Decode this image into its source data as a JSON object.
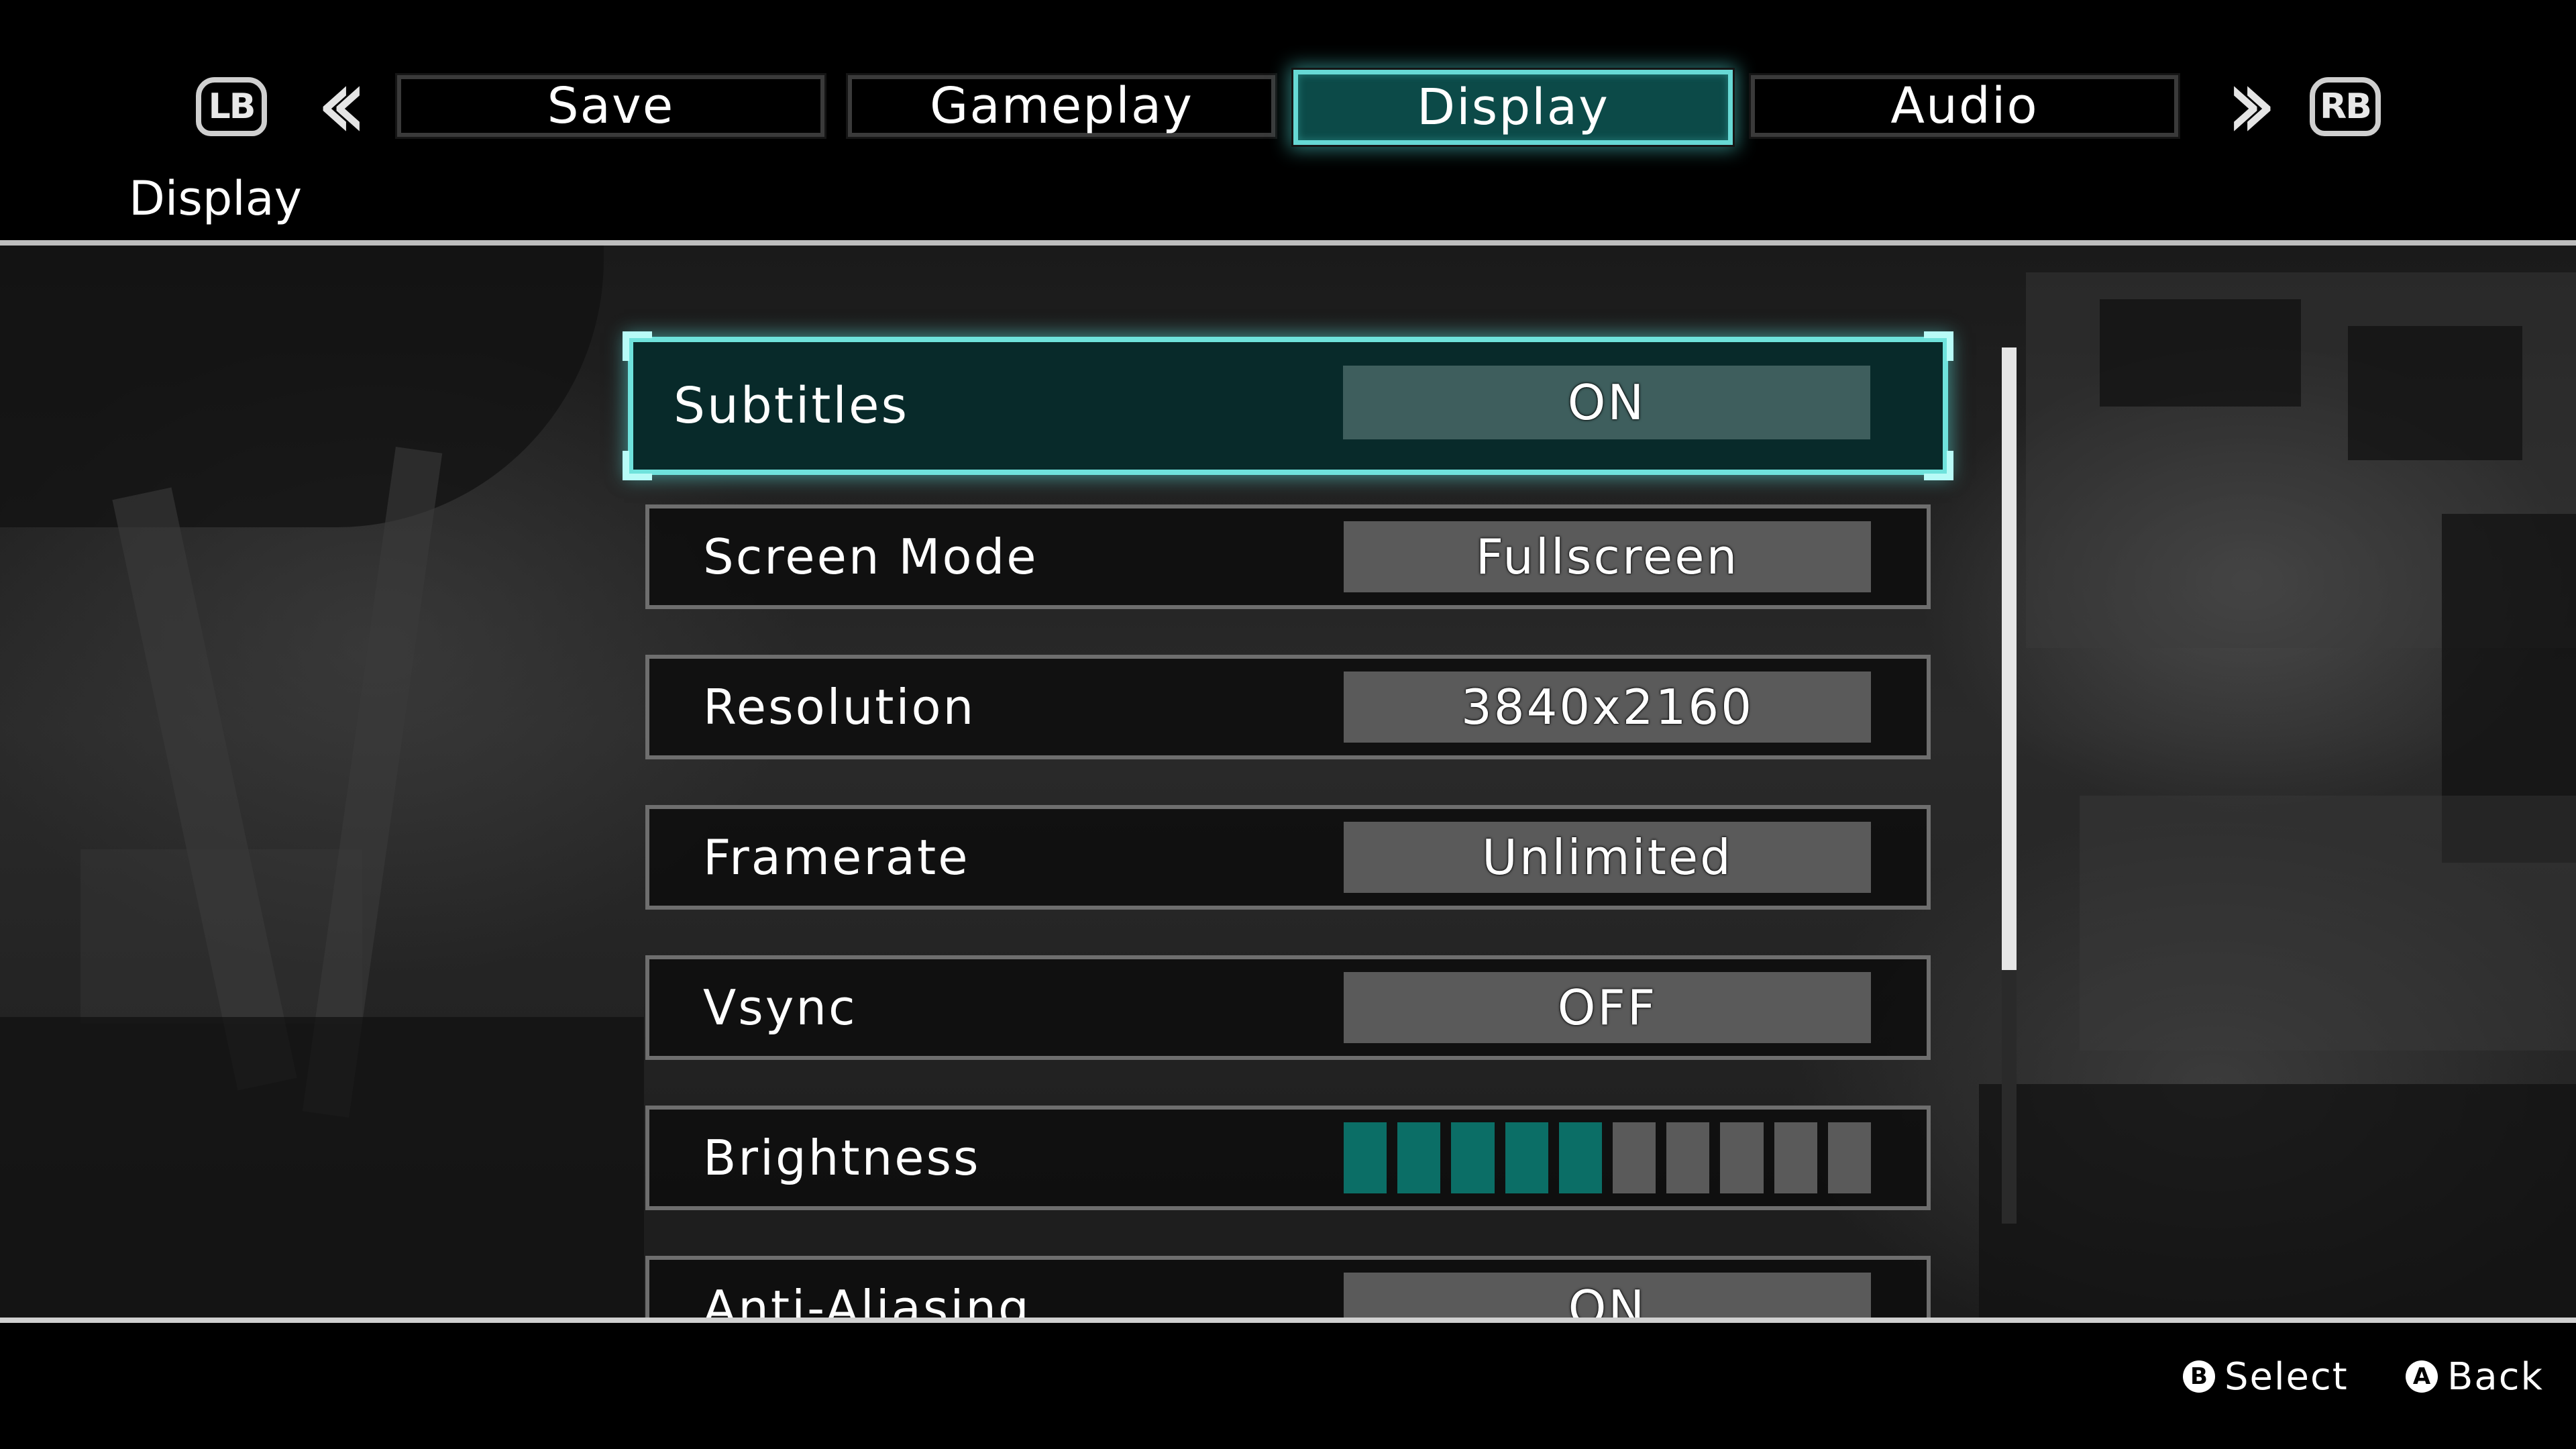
{
  "header": {
    "left_bumper": "LB",
    "right_bumper": "RB",
    "tabs": [
      {
        "label": "Save"
      },
      {
        "label": "Gameplay"
      },
      {
        "label": "Display"
      },
      {
        "label": "Audio"
      }
    ],
    "active_tab": "Display",
    "page_title": "Display"
  },
  "settings": [
    {
      "label": "Subtitles",
      "value": "ON"
    },
    {
      "label": "Screen Mode",
      "value": "Fullscreen"
    },
    {
      "label": "Resolution",
      "value": "3840x2160"
    },
    {
      "label": "Framerate",
      "value": "Unlimited"
    },
    {
      "label": "Vsync",
      "value": "OFF"
    },
    {
      "label": "Brightness",
      "level": 5,
      "max": 10
    },
    {
      "label": "Anti-Aliasing",
      "value": "ON"
    }
  ],
  "footer": {
    "select_glyph": "B",
    "select_label": "Select",
    "back_glyph": "A",
    "back_label": "Back"
  },
  "colors": {
    "accent": "#67d9d5",
    "active_tab_fill": "#0c4a48",
    "brightness_on": "#0b6e66",
    "value_box": "#5a5a5a"
  }
}
